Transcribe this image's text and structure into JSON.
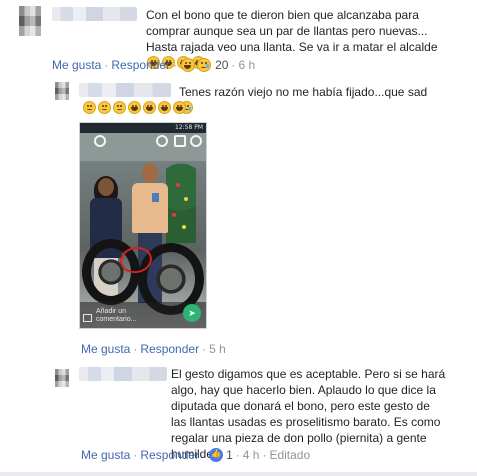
{
  "comment1": {
    "text": "Con el bono que te dieron bien que alcanzaba para comprar aunque sea un par de llantas pero nuevas... Hasta rajada veo una llanta. Se va ir a matar el alcalde",
    "like_label": "Me gusta",
    "reply_label": "Responder",
    "reaction_count": "20",
    "time": "6 h"
  },
  "reply1": {
    "text": "Tenes razón viejo no me había fijado...que sad",
    "like_label": "Me gusta",
    "reply_label": "Responder",
    "time": "5 h",
    "image": {
      "status_time": "12:58 PM",
      "comment_placeholder": "Añadir un comentario..."
    }
  },
  "reply2": {
    "text": "El gesto digamos que es aceptable. Pero si se hará algo, hay que hacerlo bien. Aplaudo lo que dice la diputada que donará el bono, pero este gesto de las llantas usadas es proselitismo barato. Es como regalar una pieza de don pollo (piernita) a gente humilde.",
    "like_label": "Me gusta",
    "reply_label": "Responder",
    "reaction_count": "1",
    "time": "4 h",
    "edited_label": "Editado"
  },
  "colors": {
    "link": "#4267b2",
    "text": "#1d2129",
    "meta": "#90949c",
    "like_blue": "#4b7be5",
    "emoji_yellow": "#f7c744"
  }
}
